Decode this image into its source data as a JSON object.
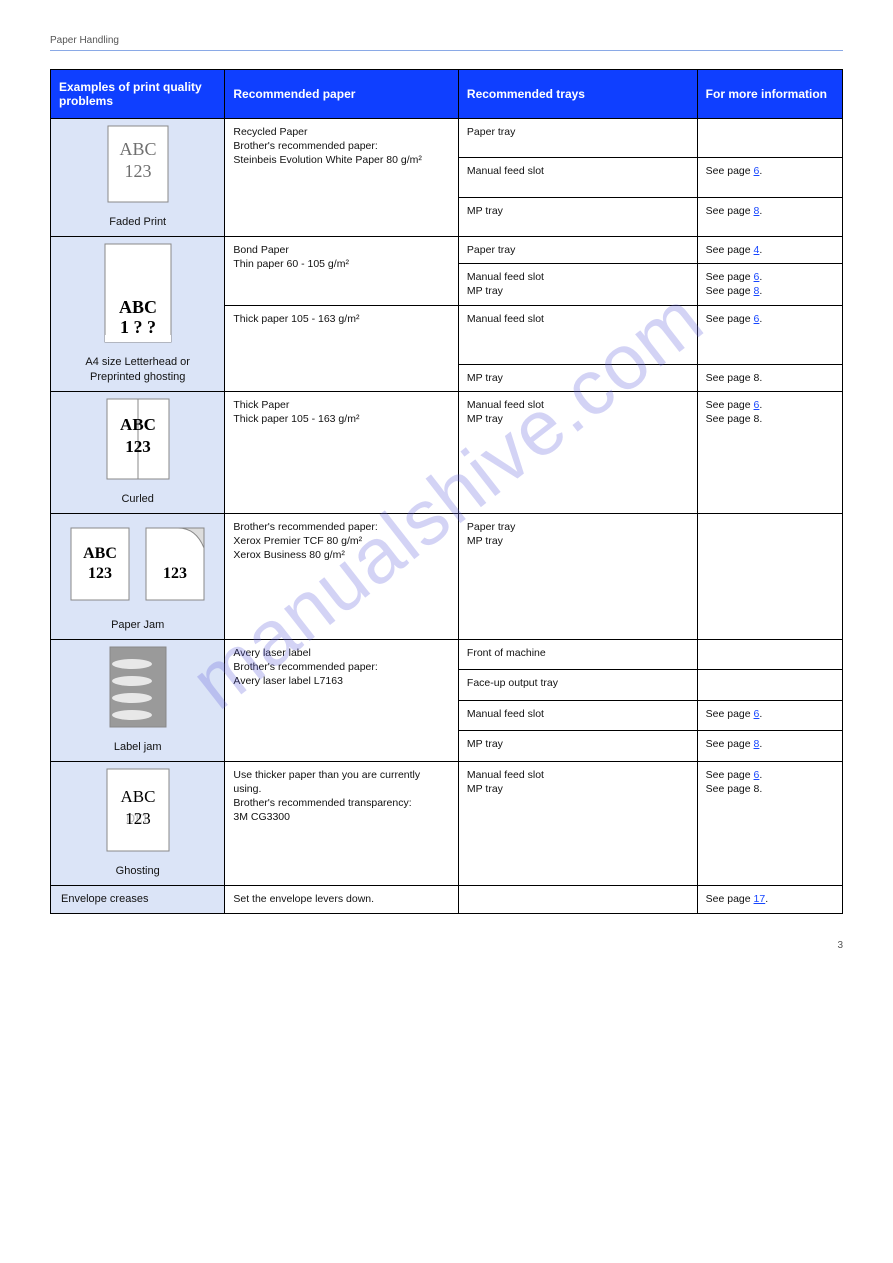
{
  "header_left": "Paper Handling",
  "watermark_text": "manualshive.com",
  "columns": {
    "c1": "Examples of print quality problems",
    "c2": "Recommended paper",
    "c3": "Recommended trays",
    "c4": "For more information"
  },
  "rows": [
    {
      "icon": "faded",
      "icon_label": "Faded Print",
      "rec": {
        "title": "Recycled Paper",
        "sub": "Brother's recommended paper:",
        "items": [
          "Steinbeis Evolution White Paper 80 g/m²"
        ]
      },
      "tray": [
        {
          "text": "Paper tray"
        },
        {
          "text": "Manual feed slot",
          "page": "6"
        },
        {
          "text": "MP tray",
          "page": "8"
        }
      ]
    },
    {
      "icon": "edge-overflow",
      "icon_label": "A4 size Letterhead or Preprinted ghosting",
      "rec": {
        "title": "Bond Paper",
        "sub": "",
        "items": [
          "Thin paper 60 - 105 g/m²"
        ]
      },
      "tray": [
        {
          "text": "Paper tray",
          "page": "4"
        },
        {
          "text": "Manual feed slot",
          "page": "6"
        },
        {
          "text": "MP tray",
          "page": "8"
        },
        {
          "text": "Thick paper 105 - 163 g/m²"
        },
        {
          "text": "Manual feed slot"
        },
        {
          "text": "MP tray"
        }
      ]
    },
    {
      "icon": "curled",
      "icon_label": "Curled",
      "rec": {
        "title": "Thick Paper",
        "sub": "",
        "items": [
          "Thick paper 105 - 163 g/m²"
        ]
      },
      "tray": [
        {
          "text": "Manual feed slot",
          "page": "6"
        },
        {
          "text": "MP tray"
        }
      ]
    },
    {
      "icon": "flip",
      "icon_label": "Paper Jam",
      "rec": {
        "title": "Brother's recommended paper:",
        "sub": "",
        "items": [
          "Xerox Premier TCF 80 g/m²",
          "Xerox Business 80 g/m²"
        ]
      },
      "tray": [
        {
          "text": "Paper tray"
        },
        {
          "text": "MP tray"
        }
      ]
    },
    {
      "icon": "label-sheet",
      "icon_label": "Label jam",
      "rec": {
        "title": "Avery laser label",
        "sub": "Brother's recommended paper:",
        "items": [
          "Avery laser label L7163"
        ]
      },
      "tray": [
        {
          "text": "Front of machine"
        },
        {
          "text": "Face-up output tray"
        },
        {
          "text": "Manual feed slot",
          "page": "6"
        },
        {
          "text": "MP tray",
          "page": "8"
        }
      ]
    },
    {
      "icon": "ghost",
      "icon_label": "Ghosting",
      "rec": {
        "title": "Use thicker paper than you are currently using.",
        "sub": "Brother's recommended transparency:",
        "items": [
          "3M CG3300"
        ]
      },
      "tray": [
        {
          "text": "Manual feed slot",
          "page": "6"
        },
        {
          "text": "MP tray"
        }
      ]
    },
    {
      "icon": "none",
      "icon_label": "Envelope creases",
      "rec": {
        "title": "Set the envelope levers down.",
        "sub": "",
        "items": []
      },
      "tray": [
        {
          "text": "See page",
          "page": "17"
        }
      ]
    }
  ],
  "footer_page": "3"
}
